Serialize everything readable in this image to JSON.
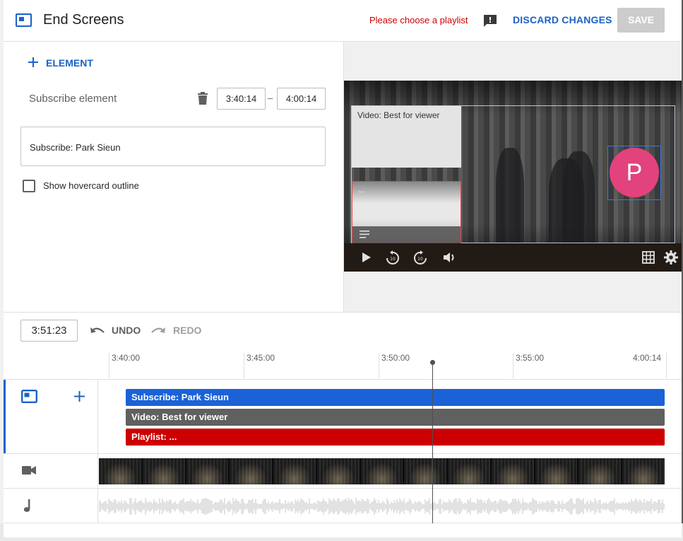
{
  "header": {
    "title": "End Screens",
    "error_message": "Please choose a playlist",
    "discard_label": "DISCARD CHANGES",
    "save_label": "SAVE"
  },
  "editor": {
    "add_element_label": "ELEMENT",
    "element_name": "Subscribe element",
    "start_time": "3:40:14",
    "end_time": "4:00:14",
    "separator": "–",
    "element_text": "Subscribe: Park Sieun",
    "checkbox_label": "Show hovercard outline",
    "checkbox_checked": false
  },
  "preview": {
    "video_card_title": "Video: Best for viewer",
    "playlist_card_text": "...",
    "avatar_letter": "P",
    "avatar_color": "#e2437c"
  },
  "timeline": {
    "current_time": "3:51:23",
    "undo_label": "UNDO",
    "redo_label": "REDO",
    "ruler_labels": [
      "3:40:00",
      "3:45:00",
      "3:50:00",
      "3:55:00",
      "4:00:14"
    ],
    "tracks": [
      {
        "label": "Subscribe: Park Sieun",
        "color": "#1a62d6"
      },
      {
        "label": "Video: Best for viewer",
        "color": "#606060"
      },
      {
        "label": "Playlist: ...",
        "color": "#cc0000"
      }
    ]
  },
  "colors": {
    "accent": "#1a62c7",
    "error": "#cc0000"
  }
}
